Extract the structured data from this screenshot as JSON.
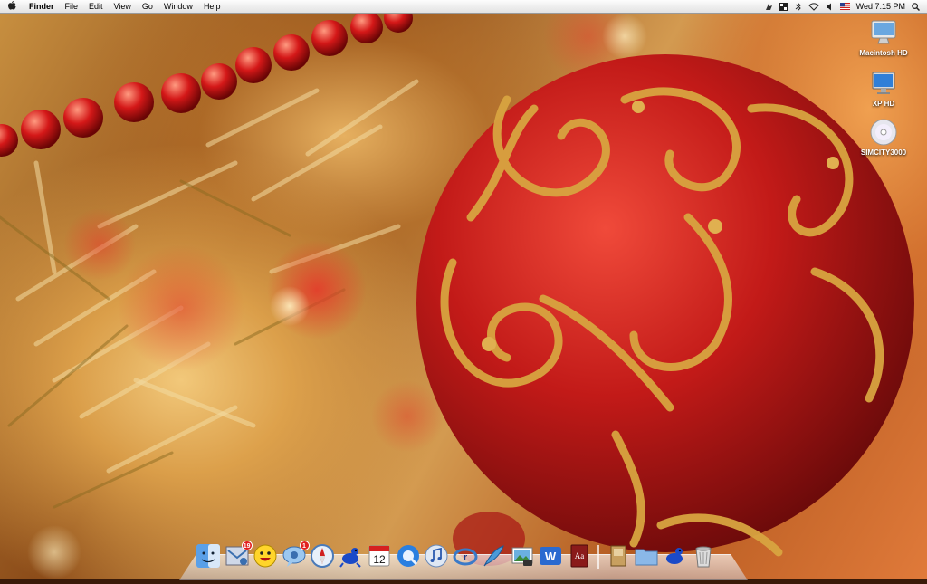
{
  "menubar": {
    "app_name": "Finder",
    "menus": [
      "File",
      "Edit",
      "View",
      "Go",
      "Window",
      "Help"
    ],
    "clock": "Wed 7:15 PM"
  },
  "desktop_icons": [
    {
      "label": "Macintosh HD",
      "icon": "imac-drive-icon"
    },
    {
      "label": "XP HD",
      "icon": "monitor-drive-icon"
    },
    {
      "label": "SIMCITY3000",
      "icon": "cd-icon"
    }
  ],
  "dock": {
    "items": [
      {
        "name": "finder",
        "icon": "finder-icon"
      },
      {
        "name": "mail",
        "icon": "mail-icon",
        "badge": "19"
      },
      {
        "name": "yahoo-messenger",
        "icon": "smiley-icon"
      },
      {
        "name": "ichat",
        "icon": "chat-icon",
        "badge": "1"
      },
      {
        "name": "safari",
        "icon": "compass-icon"
      },
      {
        "name": "frog-app",
        "icon": "frog-icon"
      },
      {
        "name": "ical",
        "icon": "calendar-icon",
        "date": "12"
      },
      {
        "name": "quicktime",
        "icon": "quicktime-icon"
      },
      {
        "name": "itunes",
        "icon": "itunes-icon"
      },
      {
        "name": "app-r",
        "icon": "r-app-icon"
      },
      {
        "name": "quill",
        "icon": "quill-icon"
      },
      {
        "name": "iphoto",
        "icon": "photo-icon"
      },
      {
        "name": "word",
        "icon": "word-icon"
      },
      {
        "name": "dictionary",
        "icon": "dictionary-icon"
      }
    ],
    "right_items": [
      {
        "name": "stack",
        "icon": "stack-icon"
      },
      {
        "name": "documents-folder",
        "icon": "folder-icon"
      },
      {
        "name": "frog-stack",
        "icon": "frog-icon"
      },
      {
        "name": "trash",
        "icon": "trash-icon"
      }
    ]
  },
  "colors": {
    "ornament_red": "#b81818",
    "gold_glitter": "#d8a440",
    "badge_red": "#e2201f"
  }
}
